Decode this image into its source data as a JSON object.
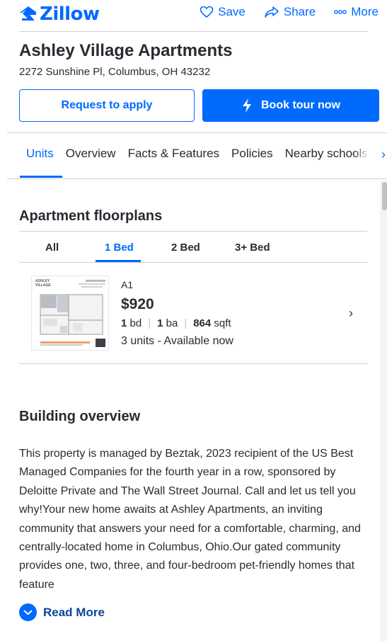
{
  "brand": {
    "name": "Zillow",
    "color": "#006aff"
  },
  "top_actions": {
    "save": "Save",
    "share": "Share",
    "more": "More"
  },
  "listing": {
    "title": "Ashley Village Apartments",
    "address": "2272 Sunshine Pl, Columbus, OH 43232"
  },
  "buttons": {
    "apply": "Request to apply",
    "tour": "Book tour now"
  },
  "tabs": [
    "Units",
    "Overview",
    "Facts & Features",
    "Policies",
    "Nearby schools"
  ],
  "floorplans": {
    "title": "Apartment floorplans",
    "bed_tabs": [
      "All",
      "1 Bed",
      "2 Bed",
      "3+ Bed"
    ],
    "active_bed_tab": "1 Bed",
    "units": [
      {
        "name": "A1",
        "price": "$920",
        "beds": "1",
        "beds_unit": "bd",
        "baths": "1",
        "baths_unit": "ba",
        "sqft": "864",
        "sqft_unit": "sqft",
        "availability": "3 units - Available now",
        "thumb_logo": "ASHLEY VILLAGE"
      }
    ]
  },
  "overview": {
    "title": "Building overview",
    "text": "This property is managed by Beztak, 2023 recipient of the US Best Managed Companies for the fourth year in a row, sponsored by Deloitte Private and The Wall Street Journal. Call and let us tell you why!Your new home awaits at Ashley Apartments, an inviting community that answers your need for a comfortable, charming, and centrally-located home in Columbus, Ohio.Our gated community provides one, two, three, and four-bedroom pet-friendly homes that feature",
    "read_more": "Read More"
  }
}
